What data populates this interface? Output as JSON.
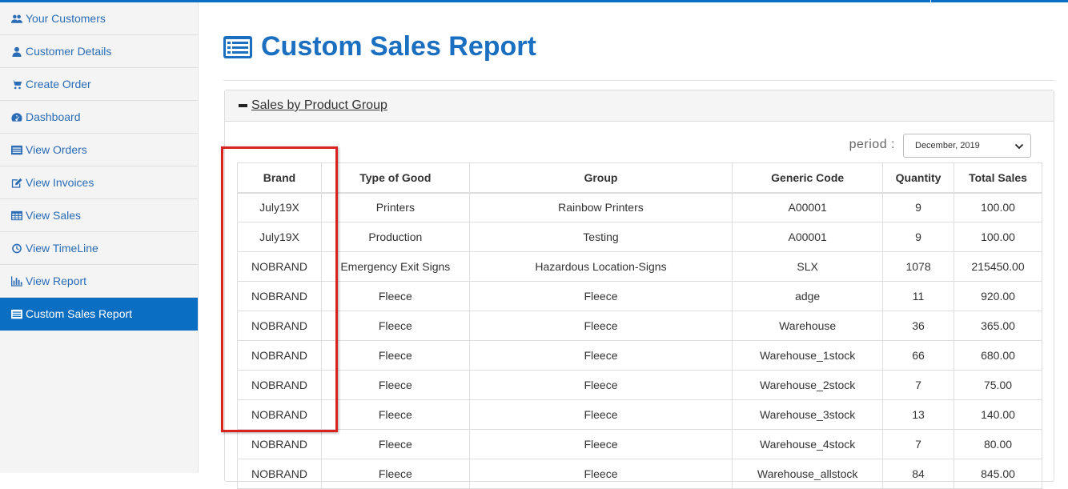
{
  "sidebar": {
    "items": [
      {
        "label": "Your Customers",
        "icon": "users-icon"
      },
      {
        "label": "Customer Details",
        "icon": "user-icon"
      },
      {
        "label": "Create Order",
        "icon": "cart-icon"
      },
      {
        "label": "Dashboard",
        "icon": "dashboard-icon"
      },
      {
        "label": "View Orders",
        "icon": "list-icon"
      },
      {
        "label": "View Invoices",
        "icon": "edit-icon"
      },
      {
        "label": "View Sales",
        "icon": "table-icon"
      },
      {
        "label": "View TimeLine",
        "icon": "clock-icon"
      },
      {
        "label": "View Report",
        "icon": "bar-chart-icon"
      },
      {
        "label": "Custom Sales Report",
        "icon": "list-alt-icon",
        "active": true
      }
    ]
  },
  "page": {
    "title": "Custom Sales Report"
  },
  "panel": {
    "heading": "Sales by Product Group",
    "period_label": "period :",
    "period_value": "December, 2019"
  },
  "table": {
    "headers": [
      "Brand",
      "Type of Good",
      "Group",
      "Generic Code",
      "Quantity",
      "Total Sales"
    ],
    "rows": [
      [
        "July19X",
        "Printers",
        "Rainbow Printers",
        "A00001",
        "9",
        "100.00"
      ],
      [
        "July19X",
        "Production",
        "Testing",
        "A00001",
        "9",
        "100.00"
      ],
      [
        "NOBRAND",
        "Emergency Exit Signs",
        "Hazardous Location-Signs",
        "SLX",
        "1078",
        "215450.00"
      ],
      [
        "NOBRAND",
        "Fleece",
        "Fleece",
        "adge",
        "11",
        "920.00"
      ],
      [
        "NOBRAND",
        "Fleece",
        "Fleece",
        "Warehouse",
        "36",
        "365.00"
      ],
      [
        "NOBRAND",
        "Fleece",
        "Fleece",
        "Warehouse_1stock",
        "66",
        "680.00"
      ],
      [
        "NOBRAND",
        "Fleece",
        "Fleece",
        "Warehouse_2stock",
        "7",
        "75.00"
      ],
      [
        "NOBRAND",
        "Fleece",
        "Fleece",
        "Warehouse_3stock",
        "13",
        "140.00"
      ],
      [
        "NOBRAND",
        "Fleece",
        "Fleece",
        "Warehouse_4stock",
        "7",
        "80.00"
      ],
      [
        "NOBRAND",
        "Fleece",
        "Fleece",
        "Warehouse_allstock",
        "84",
        "845.00"
      ]
    ]
  },
  "colors": {
    "accent": "#0a6fc2",
    "link": "#2a6cb5",
    "highlight": "#d9231f"
  }
}
